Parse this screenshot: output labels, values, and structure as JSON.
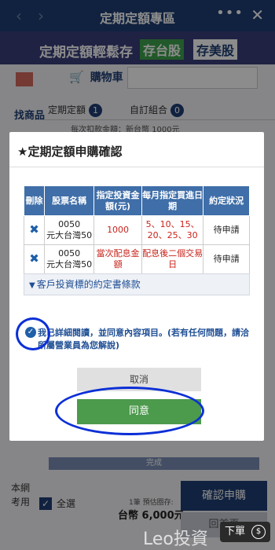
{
  "app": {
    "title": "定期定額專區",
    "back_icon": "‹",
    "forward_icon": "›",
    "more_icon": "•••",
    "close_icon": "✕"
  },
  "banner": {
    "main": "定期定額輕鬆存",
    "tw_stock": "存台股",
    "us_stock": "存美股"
  },
  "page": {
    "cart_label": "購物車",
    "side_tab": "找商品",
    "tabs": [
      {
        "label": "定期定額",
        "count": "1"
      },
      {
        "label": "自訂組合",
        "count": "0"
      }
    ],
    "deduct_note": "每次扣款金額：新台幣 1000元",
    "complete_label": "完成",
    "left_note": "本網\n考用",
    "select_all": "全選",
    "estimate_label": "1筆 預估圈存:",
    "estimate_amount": "台幣 6,000元",
    "confirm_label": "確認申購",
    "back_label": "回首頁",
    "order_label": "下單",
    "order_coin": "$",
    "watermark": "Leo投資"
  },
  "dialog": {
    "title": "★定期定額申購確認",
    "columns": [
      "刪除",
      "股票名稱",
      "指定投資金額(元)",
      "每月指定買進日期",
      "約定狀況"
    ],
    "rows": [
      {
        "code": "0050",
        "name": "元大台灣50",
        "amount": "1000",
        "dates": "5、10、15、20、25、30",
        "status": "待申請"
      },
      {
        "code": "0050",
        "name": "元大台灣50",
        "amount": "當次配息金額",
        "dates": "配息後二個交易日",
        "status": "待申請"
      }
    ],
    "terms_label": "客戶投資標的約定書條款",
    "agree_text": "我已詳細閱讀，並同意內容項目。(若有任何問題，請洽所屬營業員為您解說)",
    "cancel_label": "取消",
    "agree_label": "同意"
  }
}
